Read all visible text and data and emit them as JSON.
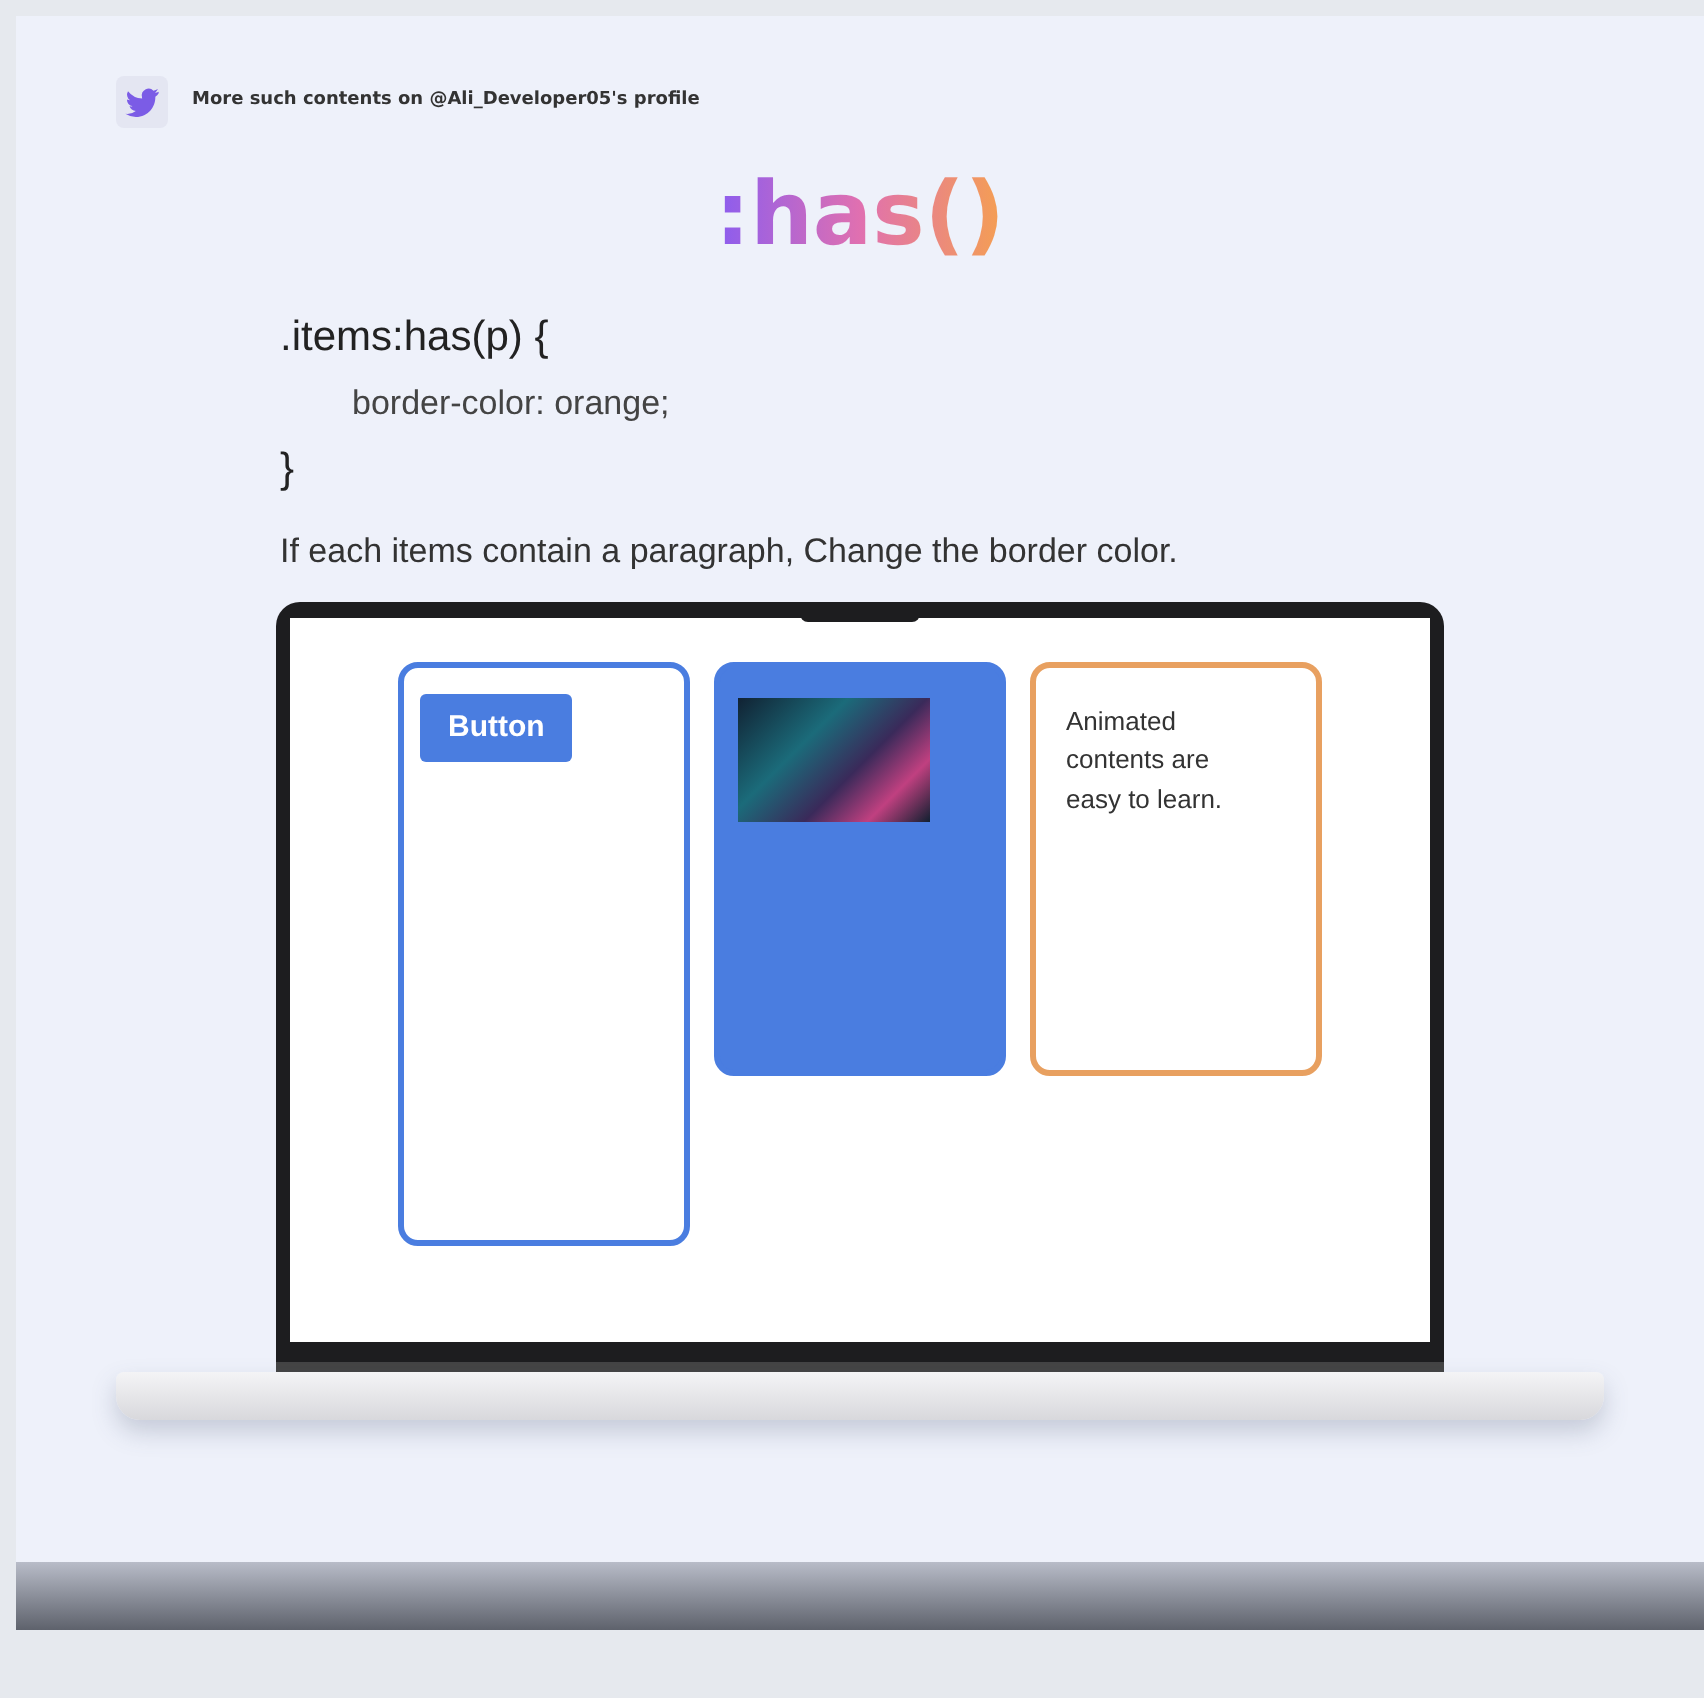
{
  "credit": {
    "text": "More such contents on @Ali_Developer05's profile"
  },
  "title": ":has()",
  "code": [
    {
      "text": ".items:has(p) {",
      "indent": false
    },
    {
      "text": "border-color: orange;",
      "indent": true
    },
    {
      "text": "}",
      "indent": false
    }
  ],
  "caption": "If each items contain a paragraph, Change the border color.",
  "cards": [
    {
      "kind": "button",
      "label": "Button",
      "color": "#4a7de0"
    },
    {
      "kind": "image",
      "color": "#4a7de0"
    },
    {
      "kind": "text",
      "text": "Animated contents are easy to learn.",
      "color": "#e8a060"
    }
  ]
}
